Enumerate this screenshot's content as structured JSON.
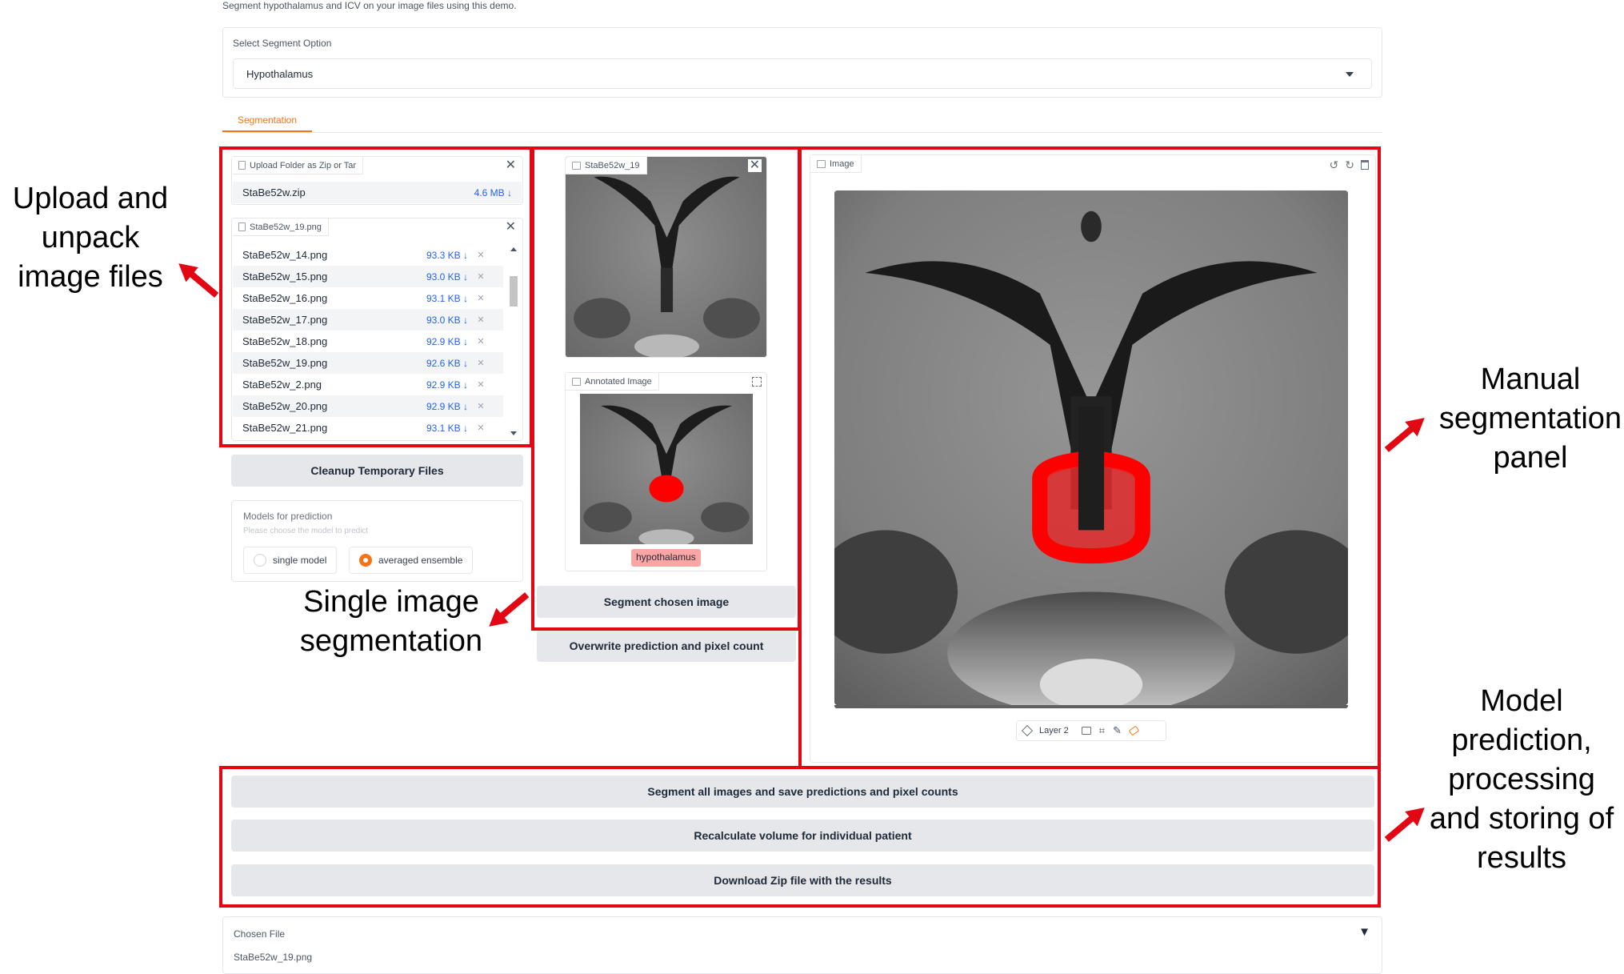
{
  "header": {
    "subtitle": "Segment hypothalamus and ICV on your image files using this demo."
  },
  "segment_option": {
    "label": "Select Segment Option",
    "value": "Hypothalamus"
  },
  "tabs": [
    {
      "label": "Segmentation"
    }
  ],
  "upload": {
    "label": "Upload Folder as Zip or Tar",
    "file_name": "StaBe52w.zip",
    "file_size": "4.6 MB ↓"
  },
  "file_list": {
    "label": "StaBe52w_19.png",
    "files": [
      {
        "name": "StaBe52w_14.png",
        "size": "93.3 KB ↓"
      },
      {
        "name": "StaBe52w_15.png",
        "size": "93.0 KB ↓"
      },
      {
        "name": "StaBe52w_16.png",
        "size": "93.1 KB ↓"
      },
      {
        "name": "StaBe52w_17.png",
        "size": "93.0 KB ↓"
      },
      {
        "name": "StaBe52w_18.png",
        "size": "92.9 KB ↓"
      },
      {
        "name": "StaBe52w_19.png",
        "size": "92.6 KB ↓"
      },
      {
        "name": "StaBe52w_2.png",
        "size": "92.9 KB ↓"
      },
      {
        "name": "StaBe52w_20.png",
        "size": "92.9 KB ↓"
      },
      {
        "name": "StaBe52w_21.png",
        "size": "93.1 KB ↓"
      }
    ]
  },
  "cleanup_button": "Cleanup Temporary Files",
  "models": {
    "label": "Models for prediction",
    "info": "Please choose the model to predict",
    "options": [
      "single model",
      "averaged ensemble"
    ],
    "selected": "averaged ensemble"
  },
  "single_image": {
    "label": "StaBe52w_19"
  },
  "annotated": {
    "label": "Annotated Image",
    "tag": "hypothalamus"
  },
  "segment_chosen_button": "Segment chosen image",
  "overwrite_button": "Overwrite prediction and pixel count",
  "editor": {
    "label": "Image",
    "layer": "Layer 2"
  },
  "actions": {
    "segment_all": "Segment all images and save predictions and pixel counts",
    "recalculate": "Recalculate volume for individual patient",
    "download": "Download Zip file with the results"
  },
  "chosen_file": {
    "label": "Chosen File",
    "value": "StaBe52w_19.png",
    "toggle": "▼"
  },
  "annotations": {
    "upload": "Upload and unpack image files",
    "single": "Single image segmentation",
    "manual": "Manual segmentation panel",
    "model": "Model prediction, processing and storing of results"
  },
  "colors": {
    "accent": "#f97316",
    "annotation_red": "#e30613",
    "mask_red": "#ff0000",
    "link_blue": "#2563eb"
  },
  "icons": [
    "file-icon",
    "image-icon",
    "close-icon",
    "caret-down-icon",
    "undo-icon",
    "redo-icon",
    "trash-icon",
    "layers-icon",
    "crop-icon",
    "brush-icon",
    "eraser-icon",
    "fullscreen-icon",
    "arrow-icon"
  ]
}
